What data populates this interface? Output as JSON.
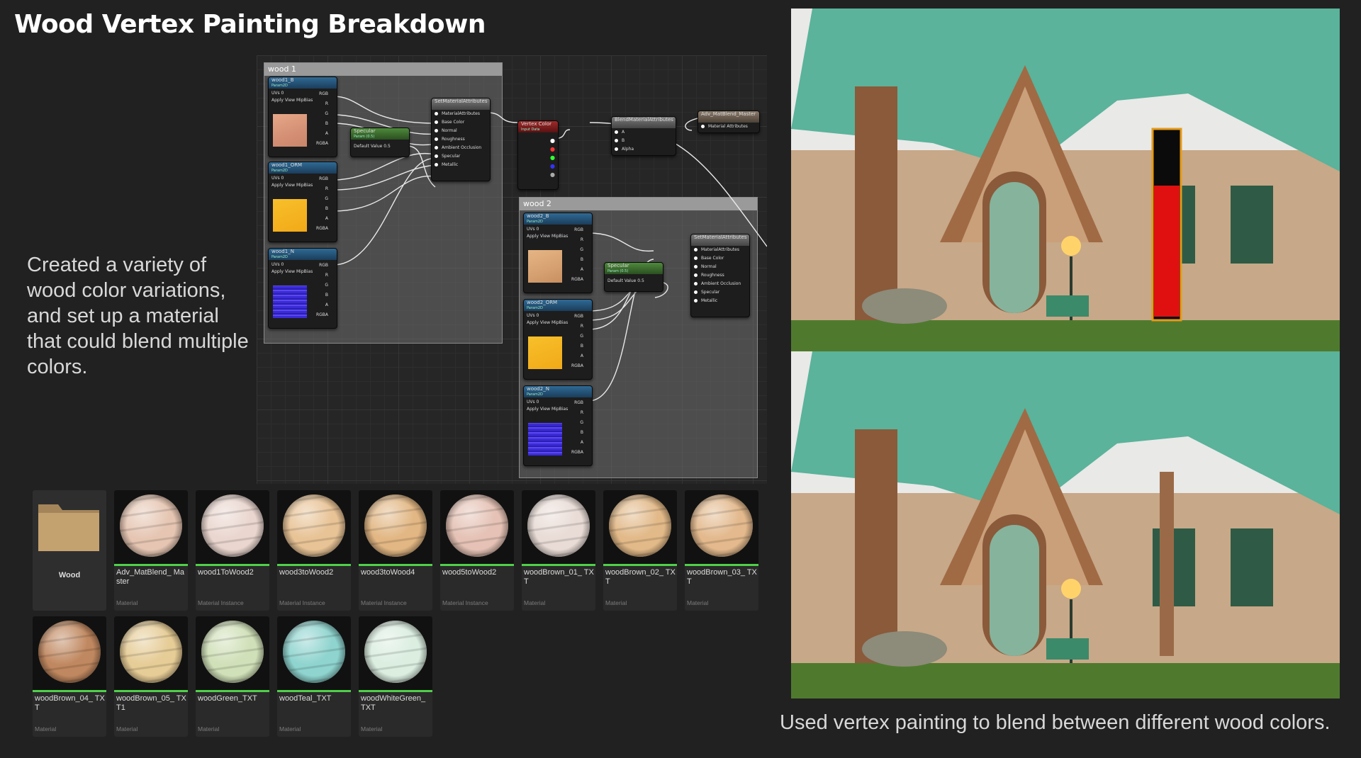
{
  "title": "Wood Vertex Painting Breakdown",
  "description": "Created a variety of wood color variations, and set up a material that could blend multiple colors.",
  "caption": "Used vertex painting to blend between different wood colors.",
  "graph": {
    "comments": [
      "wood 1",
      "wood 2"
    ],
    "nodes": {
      "wood1_b": {
        "title": "wood1_B",
        "sub": "Param2D",
        "uvs": "UVs",
        "uv_val": "0",
        "mip": "Apply View MipBias",
        "pins": [
          "RGB",
          "R",
          "G",
          "B",
          "A",
          "RGBA"
        ]
      },
      "wood1_orm": {
        "title": "wood1_ORM",
        "sub": "Param2D",
        "uvs": "UVs",
        "uv_val": "0",
        "mip": "Apply View MipBias",
        "pins": [
          "RGB",
          "R",
          "G",
          "B",
          "A",
          "RGBA"
        ]
      },
      "wood1_n": {
        "title": "wood1_N",
        "sub": "Param2D",
        "uvs": "UVs",
        "uv_val": "0",
        "mip": "Apply View MipBias",
        "pins": [
          "RGB",
          "R",
          "G",
          "B",
          "A",
          "RGBA"
        ]
      },
      "wood2_b": {
        "title": "wood2_B",
        "sub": "Param2D",
        "uvs": "UVs",
        "uv_val": "0",
        "mip": "Apply View MipBias",
        "pins": [
          "RGB",
          "R",
          "G",
          "B",
          "A",
          "RGBA"
        ]
      },
      "wood2_orm": {
        "title": "wood2_ORM",
        "sub": "Param2D",
        "uvs": "UVs",
        "uv_val": "0",
        "mip": "Apply View MipBias",
        "pins": [
          "RGB",
          "R",
          "G",
          "B",
          "A",
          "RGBA"
        ]
      },
      "wood2_n": {
        "title": "wood2_N",
        "sub": "Param2D",
        "uvs": "UVs",
        "uv_val": "0",
        "mip": "Apply View MipBias",
        "pins": [
          "RGB",
          "R",
          "G",
          "B",
          "A",
          "RGBA"
        ]
      },
      "specular1": {
        "title": "Specular",
        "sub": "Param (0.5)",
        "label": "Default Value",
        "value": "0.5"
      },
      "specular2": {
        "title": "Specular",
        "sub": "Param (0.5)",
        "label": "Default Value",
        "value": "0.5"
      },
      "setmat1": {
        "title": "SetMaterialAttributes",
        "pins": [
          "MaterialAttributes",
          "Base Color",
          "Normal",
          "Roughness",
          "Ambient Occlusion",
          "Specular",
          "Metallic"
        ]
      },
      "setmat2": {
        "title": "SetMaterialAttributes",
        "pins": [
          "MaterialAttributes",
          "Base Color",
          "Normal",
          "Roughness",
          "Ambient Occlusion",
          "Specular",
          "Metallic"
        ]
      },
      "vertex": {
        "title": "Vertex Color",
        "sub": "Input Data"
      },
      "blend": {
        "title": "BlendMaterialAttributes",
        "pins": [
          "A",
          "B",
          "Alpha"
        ]
      },
      "master": {
        "title": "Adv_MatBlend_Master",
        "pins": [
          "Material Attributes"
        ]
      }
    }
  },
  "assets": [
    {
      "name": "Wood",
      "type": "",
      "kind": "folder"
    },
    {
      "name": "Adv_MatBlend_ Master",
      "type": "Material",
      "color": "#e6c6b3"
    },
    {
      "name": "wood1ToWood2",
      "type": "Material Instance",
      "color": "#ead6cf"
    },
    {
      "name": "wood3toWood2",
      "type": "Material Instance",
      "color": "#e8c396"
    },
    {
      "name": "wood3toWood4",
      "type": "Material Instance",
      "color": "#e2b784"
    },
    {
      "name": "wood5toWood2",
      "type": "Material Instance",
      "color": "#e5c2b5"
    },
    {
      "name": "woodBrown_01_ TXT",
      "type": "Material",
      "color": "#e9dcd6"
    },
    {
      "name": "woodBrown_02_ TXT",
      "type": "Material",
      "color": "#e2b988"
    },
    {
      "name": "woodBrown_03_ TXT",
      "type": "Material",
      "color": "#e3b98d"
    },
    {
      "name": "woodBrown_04_ TXT",
      "type": "Material",
      "color": "#c08860"
    },
    {
      "name": "woodBrown_05_ TXT1",
      "type": "Material",
      "color": "#e6cc96"
    },
    {
      "name": "woodGreen_TXT",
      "type": "Material",
      "color": "#d0e0b8"
    },
    {
      "name": "woodTeal_TXT",
      "type": "Material",
      "color": "#8fd4cf"
    },
    {
      "name": "woodWhiteGreen_ TXT",
      "type": "Material",
      "color": "#dbeee0"
    }
  ]
}
